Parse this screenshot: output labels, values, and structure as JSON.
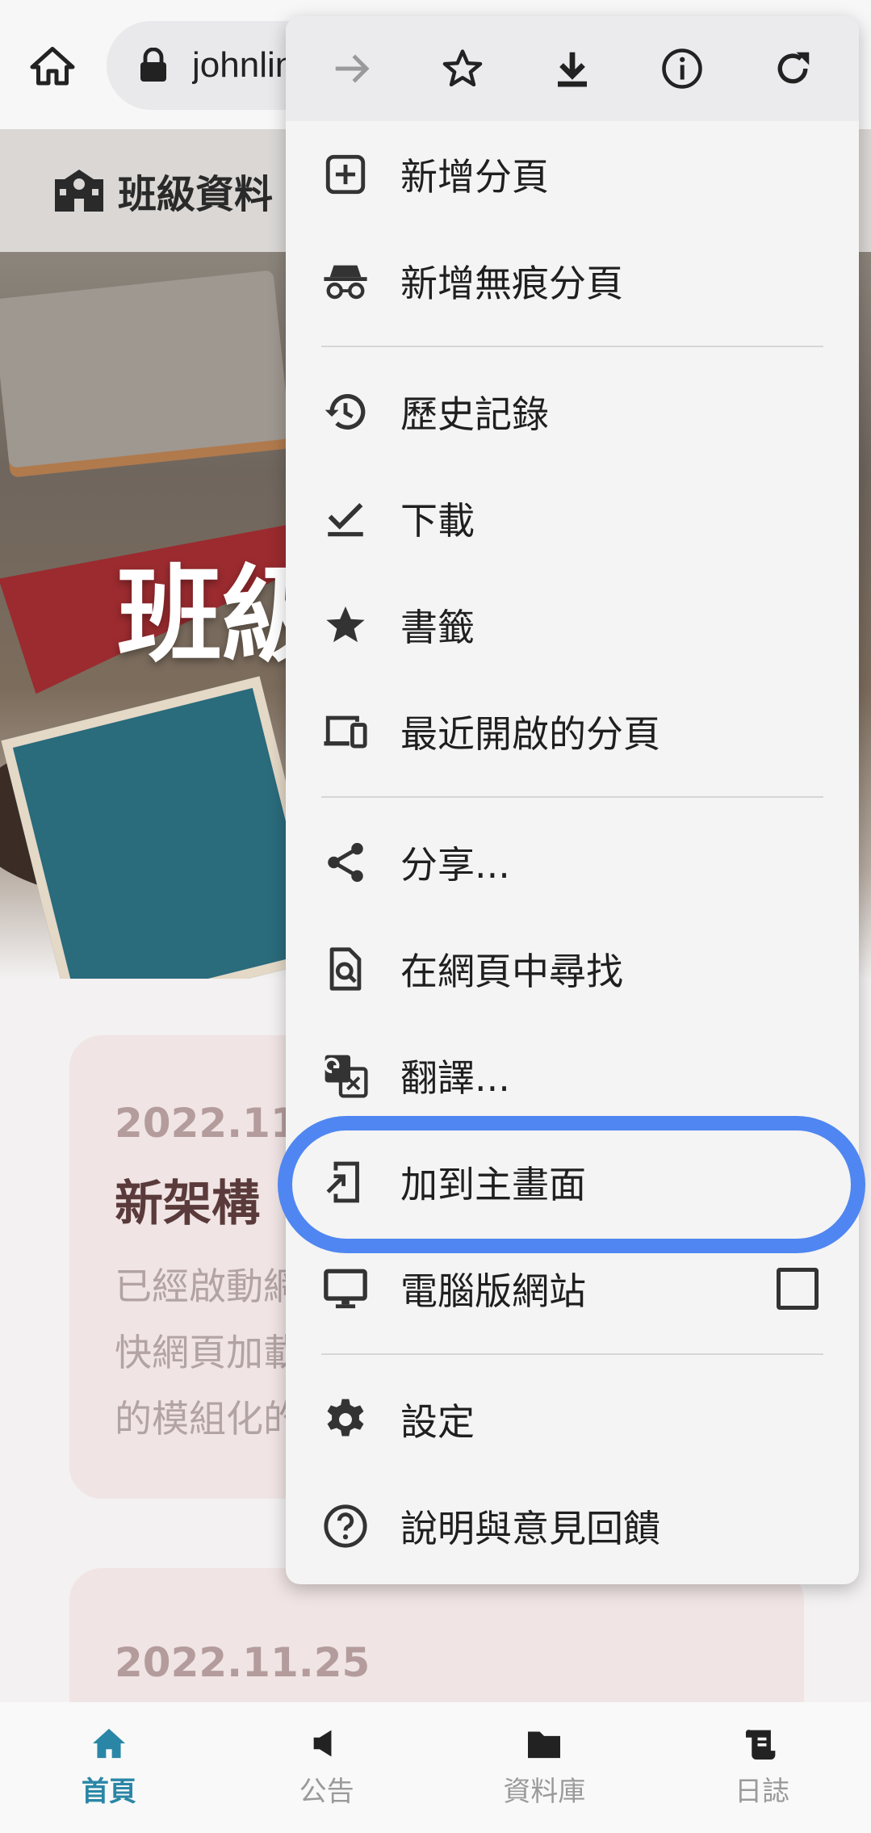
{
  "browser": {
    "url": "johnlin"
  },
  "site": {
    "header_title": "班級資料",
    "hero_title": "班級"
  },
  "cards": [
    {
      "date": "2022.11.",
      "headline": "新架構",
      "body_lines": [
        "已經啟動網",
        "快網頁加載",
        "的模組化的"
      ]
    },
    {
      "date": "2022.11.25"
    }
  ],
  "menu": {
    "items": [
      {
        "label": "新增分頁",
        "icon": "new-tab-icon"
      },
      {
        "label": "新增無痕分頁",
        "icon": "incognito-icon"
      },
      {
        "label": "歷史記錄",
        "icon": "history-icon"
      },
      {
        "label": "下載",
        "icon": "downloads-icon"
      },
      {
        "label": "書籤",
        "icon": "bookmarks-icon"
      },
      {
        "label": "最近開啟的分頁",
        "icon": "recent-tabs-icon"
      },
      {
        "label": "分享...",
        "icon": "share-icon"
      },
      {
        "label": "在網頁中尋找",
        "icon": "find-in-page-icon"
      },
      {
        "label": "翻譯...",
        "icon": "translate-icon"
      },
      {
        "label": "加到主畫面",
        "icon": "add-to-home-icon",
        "highlighted": true
      },
      {
        "label": "電腦版網站",
        "icon": "desktop-icon",
        "checked": false
      },
      {
        "label": "設定",
        "icon": "settings-icon"
      },
      {
        "label": "說明與意見回饋",
        "icon": "help-icon"
      }
    ]
  },
  "bottom_nav": {
    "items": [
      {
        "label": "首頁",
        "icon": "home-icon",
        "active": true
      },
      {
        "label": "公告",
        "icon": "megaphone-icon"
      },
      {
        "label": "資料庫",
        "icon": "folder-icon"
      },
      {
        "label": "日誌",
        "icon": "scroll-icon"
      }
    ]
  },
  "colors": {
    "highlight": "#4f86f1",
    "nav_active": "#2a86a6",
    "card_bg": "#f0e4e4"
  }
}
